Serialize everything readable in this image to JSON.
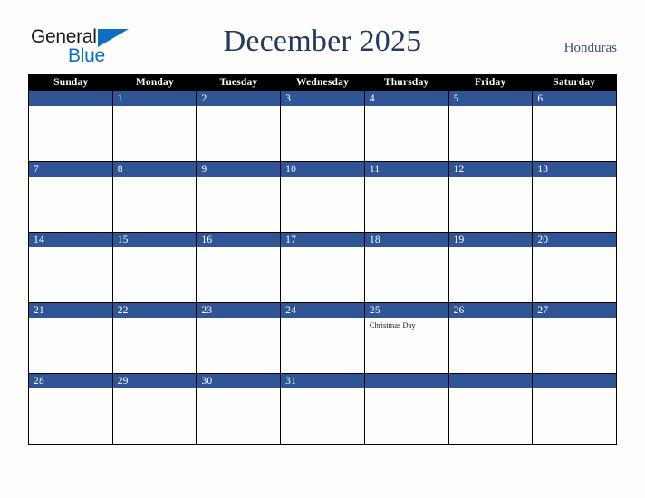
{
  "brand": {
    "name_part1": "General",
    "name_part2": "Blue",
    "triangle_icon": "blue-triangle-icon",
    "color_primary": "#0f6fc0",
    "color_text": "#1b1b1b"
  },
  "header": {
    "title": "December 2025",
    "country": "Honduras",
    "title_color": "#23395d",
    "country_color": "#3b4f76"
  },
  "calendar": {
    "month": "December",
    "year": "2025",
    "accent_color": "#2f5597",
    "header_bg": "#000000",
    "weekdays": [
      "Sunday",
      "Monday",
      "Tuesday",
      "Wednesday",
      "Thursday",
      "Friday",
      "Saturday"
    ],
    "weeks": [
      [
        {
          "day": "",
          "event": ""
        },
        {
          "day": "1",
          "event": ""
        },
        {
          "day": "2",
          "event": ""
        },
        {
          "day": "3",
          "event": ""
        },
        {
          "day": "4",
          "event": ""
        },
        {
          "day": "5",
          "event": ""
        },
        {
          "day": "6",
          "event": ""
        }
      ],
      [
        {
          "day": "7",
          "event": ""
        },
        {
          "day": "8",
          "event": ""
        },
        {
          "day": "9",
          "event": ""
        },
        {
          "day": "10",
          "event": ""
        },
        {
          "day": "11",
          "event": ""
        },
        {
          "day": "12",
          "event": ""
        },
        {
          "day": "13",
          "event": ""
        }
      ],
      [
        {
          "day": "14",
          "event": ""
        },
        {
          "day": "15",
          "event": ""
        },
        {
          "day": "16",
          "event": ""
        },
        {
          "day": "17",
          "event": ""
        },
        {
          "day": "18",
          "event": ""
        },
        {
          "day": "19",
          "event": ""
        },
        {
          "day": "20",
          "event": ""
        }
      ],
      [
        {
          "day": "21",
          "event": ""
        },
        {
          "day": "22",
          "event": ""
        },
        {
          "day": "23",
          "event": ""
        },
        {
          "day": "24",
          "event": ""
        },
        {
          "day": "25",
          "event": "Christmas Day"
        },
        {
          "day": "26",
          "event": ""
        },
        {
          "day": "27",
          "event": ""
        }
      ],
      [
        {
          "day": "28",
          "event": ""
        },
        {
          "day": "29",
          "event": ""
        },
        {
          "day": "30",
          "event": ""
        },
        {
          "day": "31",
          "event": ""
        },
        {
          "day": "",
          "event": ""
        },
        {
          "day": "",
          "event": ""
        },
        {
          "day": "",
          "event": ""
        }
      ]
    ]
  }
}
